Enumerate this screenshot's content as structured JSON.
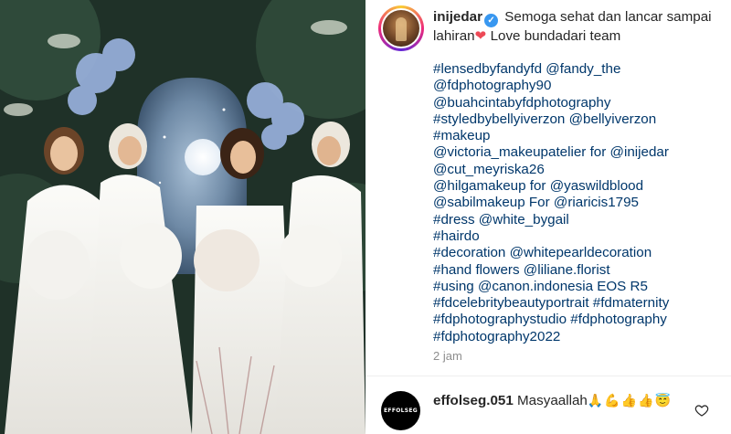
{
  "post": {
    "username": "inijedar",
    "verified_badge": "✓",
    "caption_text": "Semoga sehat dan lancar sampai lahiran",
    "caption_heart": "❤",
    "caption_suffix": "Love bundadari team",
    "caption_lines": [
      "#lensedbyfandyfd @fandy_the",
      "@fdphotography90",
      "@buahcintabyfdphotography",
      "#styledbybellyiverzon @bellyiverzon",
      "#makeup",
      "@victoria_makeupatelier for @inijedar",
      "@cut_meyriska26",
      "@hilgamakeup  for @yaswildblood",
      "@sabilmakeup For @riaricis1795",
      "#dress @white_bygail",
      "#hairdo",
      "#decoration @whitepearldecoration",
      "#hand flowers @liliane.florist",
      "#using @canon.indonesia EOS R5",
      "#fdcelebritybeautyportrait #fdmaternity",
      "#fdphotographystudio #fdphotography",
      "#fdphotography2022"
    ],
    "time_ago": "2 jam"
  },
  "comment": {
    "avatar_text": "EFFOLSEG",
    "username": "effolseg.051",
    "text": "Masyaallah",
    "emojis": "🙏💪👍👍😇",
    "like_icon": "heart-outline-icon"
  },
  "colors": {
    "link": "#00376b",
    "text": "#262626",
    "muted": "#8e8e8e",
    "verified": "#3897f0"
  }
}
